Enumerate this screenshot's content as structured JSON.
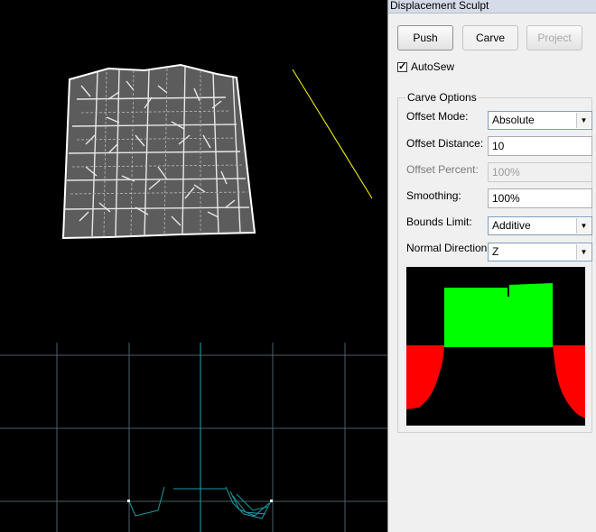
{
  "panel": {
    "title": "Displacement Sculpt",
    "buttons": {
      "push": "Push",
      "carve": "Carve",
      "project": "Project"
    },
    "autosew": {
      "label": "AutoSew",
      "checked": true,
      "check_glyph": "✓"
    },
    "carve_options": {
      "title": "Carve Options",
      "offset_mode": {
        "label": "Offset Mode:",
        "value": "Absolute"
      },
      "offset_distance": {
        "label": "Offset Distance:",
        "value": "10"
      },
      "offset_percent": {
        "label": "Offset Percent:",
        "value": "100%"
      },
      "smoothing": {
        "label": "Smoothing:",
        "value": "100%"
      },
      "bounds_limit": {
        "label": "Bounds Limit:",
        "value": "Additive"
      },
      "normal_direction": {
        "label": "Normal Direction:",
        "value": "Z"
      }
    }
  },
  "colors": {
    "viewport_bg": "#000000",
    "mesh": "#ffffff",
    "guide_line": "#ffff00",
    "grid": "#4a6068",
    "axis": "#1d8a95",
    "profile_mesh": "#1a9aa5",
    "preview_green": "#00ff00",
    "preview_red": "#ff0000"
  },
  "icons": {
    "dropdown": "chevron-down-icon",
    "checkbox": "check-icon"
  }
}
